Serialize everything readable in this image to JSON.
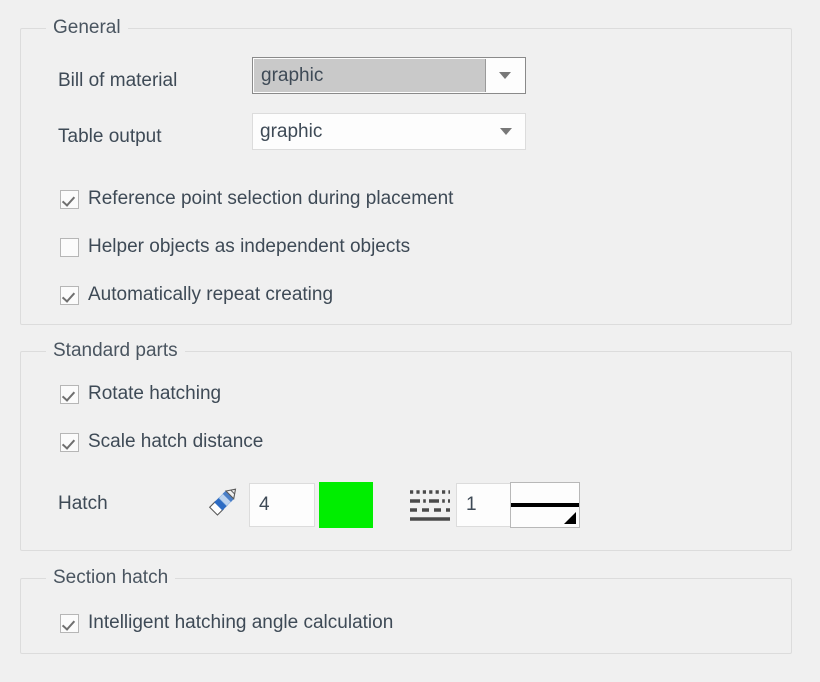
{
  "theme": {
    "background": "#f0f0f0",
    "text": "#3e4a56",
    "group_border": "#dcdcdc",
    "hatch_color": "#00ee00",
    "combo_selected_bg": "#c9c9c9"
  },
  "groups": {
    "general": {
      "legend": "General",
      "fields": [
        {
          "label": "Bill of material",
          "control": "combobox",
          "value": "graphic",
          "state": "focused"
        },
        {
          "label": "Table output",
          "control": "combobox",
          "value": "graphic",
          "state": "normal"
        }
      ],
      "checkboxes": [
        {
          "label": "Reference point selection during placement",
          "checked": true
        },
        {
          "label": "Helper objects as independent objects",
          "checked": false
        },
        {
          "label": "Automatically repeat creating",
          "checked": true
        }
      ]
    },
    "standard_parts": {
      "legend": "Standard parts",
      "checkboxes": [
        {
          "label": "Rotate hatching",
          "checked": true
        },
        {
          "label": "Scale hatch distance",
          "checked": true
        }
      ],
      "hatch": {
        "label": "Hatch",
        "pen_icon": "pencil-icon",
        "pen_value": "4",
        "color_swatch": "#00ee00",
        "linetype_icon": "line-type-icon",
        "linetype_value": "1",
        "lineweight_preview": "line-weight-preview"
      }
    },
    "section_hatch": {
      "legend": "Section hatch",
      "checkboxes": [
        {
          "label": "Intelligent hatching angle calculation",
          "checked": true
        }
      ]
    }
  }
}
